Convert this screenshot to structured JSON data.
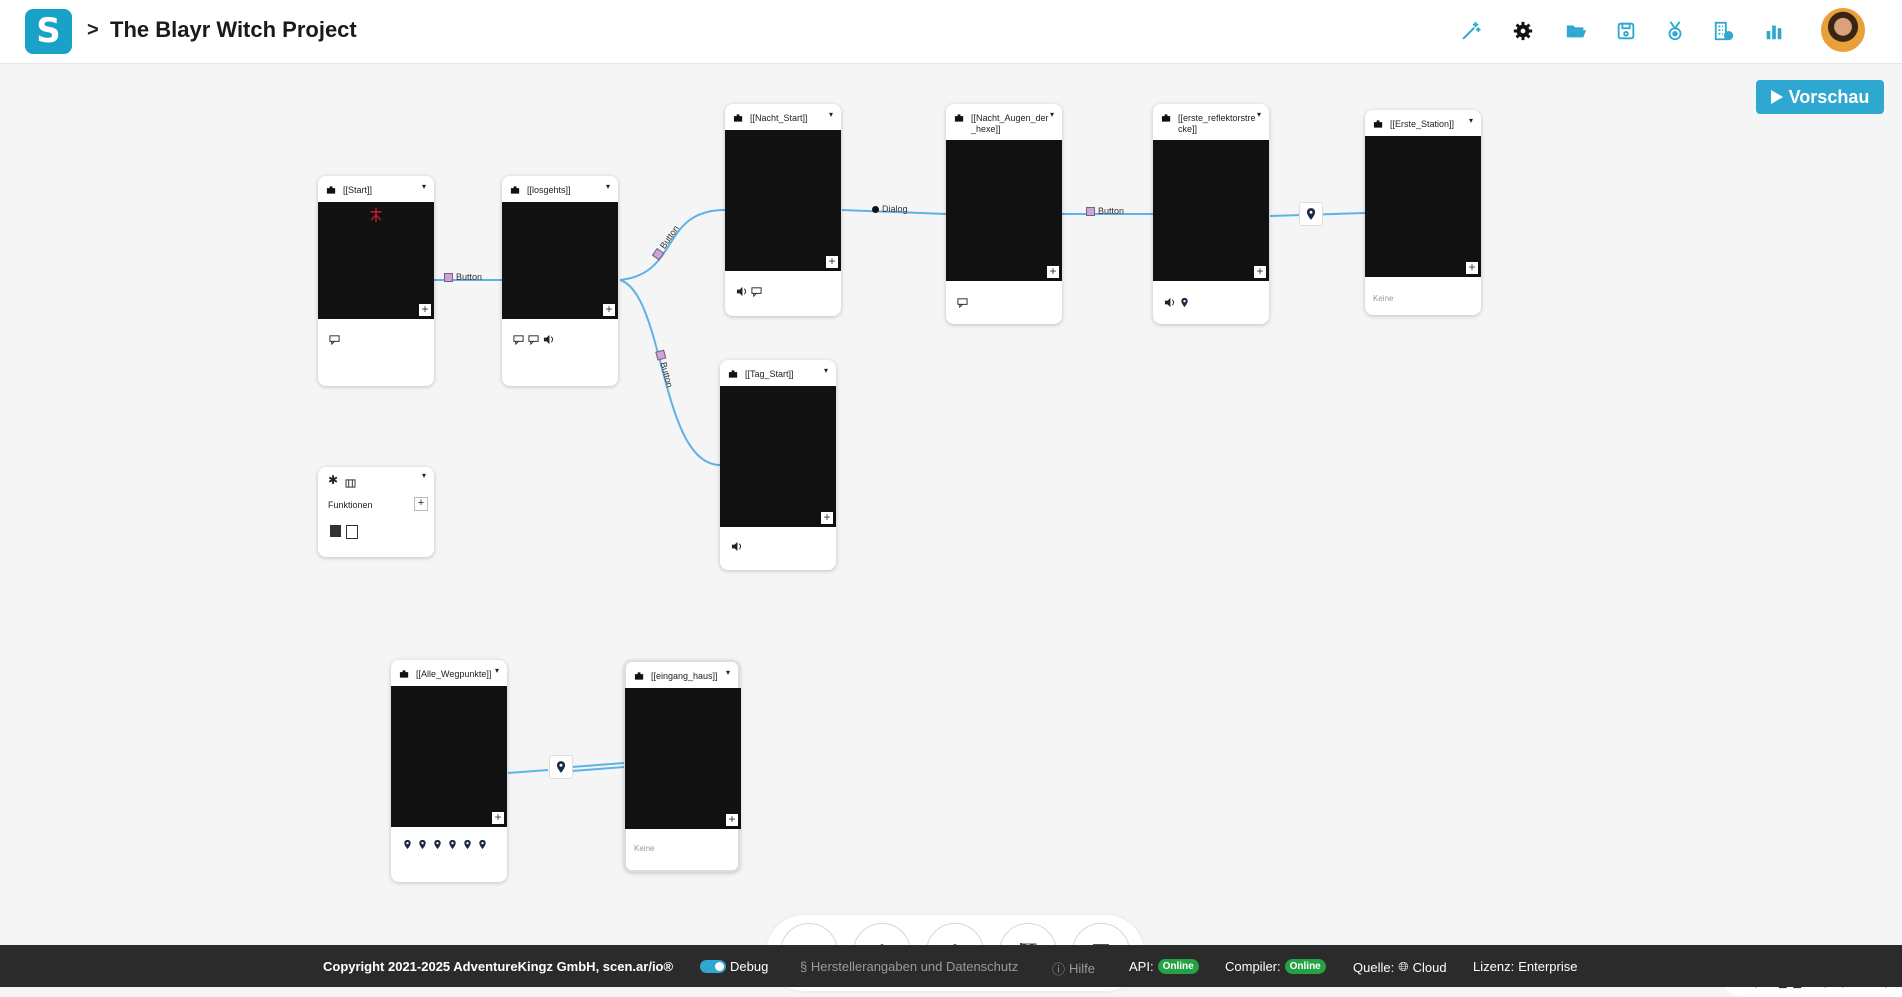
{
  "header": {
    "logo": "S",
    "separator": ">",
    "project_title": "The Blayr Witch Project",
    "icons": [
      "magic-wand-icon",
      "gear-icon",
      "folder-open-icon",
      "save-icon",
      "medal-icon",
      "building-icon",
      "bar-chart-icon"
    ],
    "accent": "#2ea8d0"
  },
  "canvas": {
    "preview_label": "Vorschau",
    "nodes": [
      {
        "name": "[[Start]]"
      },
      {
        "name": "[[losgehts]]"
      },
      {
        "name": "[[Nacht_Start]]"
      },
      {
        "name": "[[Nacht_Augen_der_hexe]]",
        "name_line1": "[[Nacht_Augen_der",
        "name_line2": "_hexe]]"
      },
      {
        "name": "[[erste_reflektorstrecke]]",
        "name_line1": "[[erste_reflektorstre",
        "name_line2": "cke]]"
      },
      {
        "name": "[[Erste_Station]]",
        "footer_text": "Keine"
      },
      {
        "name": "[[Tag_Start]]"
      },
      {
        "name": "[[Alle_Wegpunkte]]"
      },
      {
        "name": "[[eingang_haus]]",
        "footer_text": "Keine"
      }
    ],
    "functions_label": "Funktionen",
    "edge_labels": {
      "start_losgehts": "Button",
      "losgehts_nacht": "Button",
      "losgehts_tag": "Button",
      "nacht_augen": "Dialog",
      "augen_erste": "Button"
    }
  },
  "toolbar": {
    "tools": [
      "puzzle-icon",
      "asterisk-icon",
      "divide-icon",
      "checkered-flag-icon",
      "sticky-note-icon"
    ]
  },
  "zoom": {
    "controls": [
      "zoom-out-icon",
      "expand-icon",
      "compress-icon",
      "zoom-in-icon"
    ]
  },
  "footer": {
    "copyright": "Copyright 2021-2025 AdventureKingz GmbH, scen.ar/io®",
    "debug_label": "Debug",
    "imprint": "§ Herstellerangaben und Datenschutz",
    "help": "Hilfe",
    "api_label": "API:",
    "api_status": "Online",
    "compiler_label": "Compiler:",
    "compiler_status": "Online",
    "source_label": "Quelle:",
    "source_value": "Cloud",
    "license_label": "Lizenz:",
    "license_value": "Enterprise",
    "status_color": "#25a244"
  }
}
